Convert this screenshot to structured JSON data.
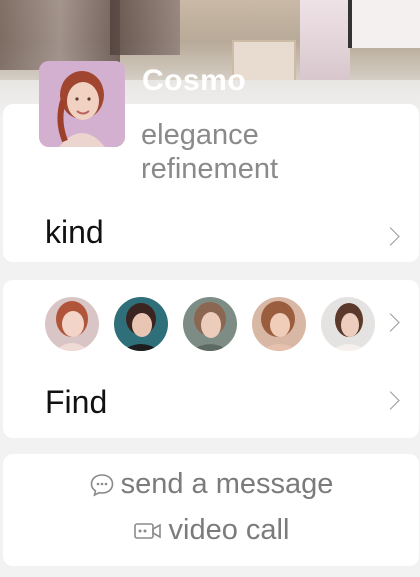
{
  "profile": {
    "username": "Cosmo",
    "tags": [
      "elegance",
      "refinement"
    ]
  },
  "kind_row": {
    "label": "kind"
  },
  "find_row": {
    "label": "Find"
  },
  "actions": {
    "message": "send a message",
    "video": "video call"
  },
  "icons": [
    "chevron-right-icon",
    "chat-bubble-icon",
    "video-camera-icon"
  ],
  "colors": {
    "background": "#f2f2f2",
    "card": "#ffffff",
    "muted_text": "#8a8a8a"
  }
}
